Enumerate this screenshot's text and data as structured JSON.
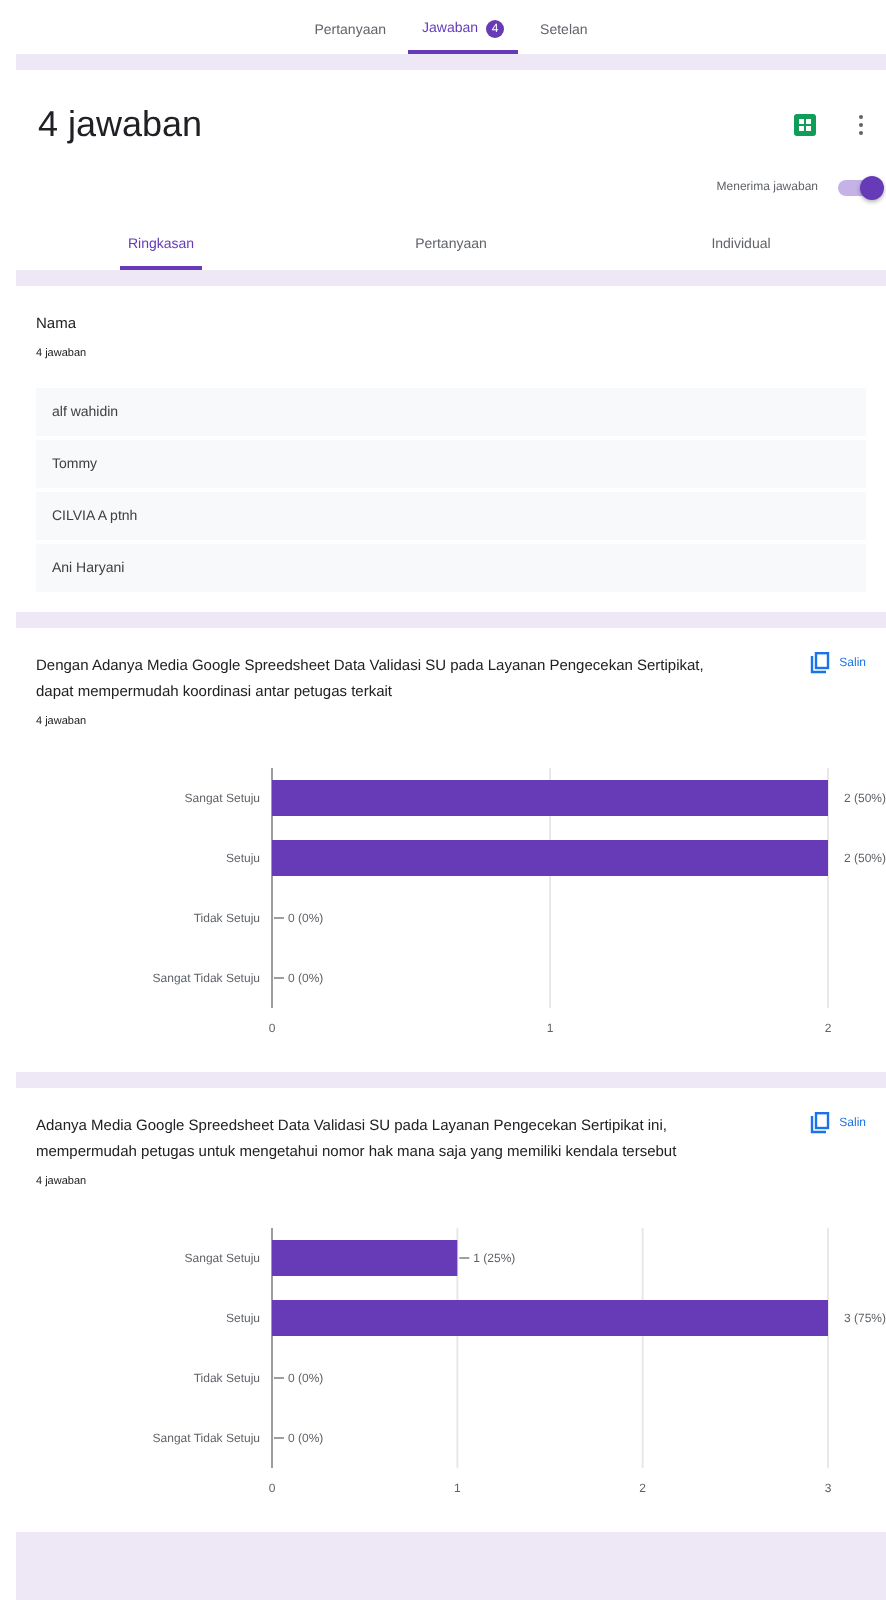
{
  "top_tabs": [
    {
      "label": "Pertanyaan",
      "selected": false
    },
    {
      "label": "Jawaban",
      "selected": true,
      "badge": "4"
    },
    {
      "label": "Setelan",
      "selected": false
    }
  ],
  "header": {
    "title": "4 jawaban",
    "accepting": {
      "label": "Menerima jawaban",
      "on": true
    }
  },
  "view_tabs": [
    {
      "label": "Ringkasan",
      "selected": true
    },
    {
      "label": "Pertanyaan",
      "selected": false
    },
    {
      "label": "Individual",
      "selected": false
    }
  ],
  "name_question": {
    "title": "Nama",
    "count": "4 jawaban",
    "answers": [
      "alf wahidin",
      "Tommy",
      "CILVIA A ptnh",
      "Ani Haryani"
    ]
  },
  "questions": [
    {
      "title": "Dengan Adanya Media Google Spreedsheet Data Validasi SU pada Layanan Pengecekan Sertipikat, dapat mempermudah koordinasi antar petugas terkait",
      "copy_label": "Salin",
      "count": "4 jawaban",
      "chart_data": {
        "type": "bar",
        "orientation": "horizontal",
        "categories": [
          "Sangat Setuju",
          "Setuju",
          "Tidak Setuju",
          "Sangat Tidak Setuju"
        ],
        "series": [
          {
            "color": "#673ab7",
            "values": [
              2,
              2,
              0,
              0
            ]
          }
        ],
        "xlim": [
          0,
          2
        ],
        "xticks": [
          0,
          1,
          2
        ],
        "value_labels": [
          "2 (50%)",
          "2 (50%)",
          "0 (0%)",
          "0 (0%)"
        ]
      }
    },
    {
      "title": "Adanya Media Google Spreedsheet Data Validasi SU pada Layanan Pengecekan Sertipikat ini, mempermudah petugas untuk mengetahui nomor hak mana saja yang memiliki kendala tersebut",
      "copy_label": "Salin",
      "count": "4 jawaban",
      "chart_data": {
        "type": "bar",
        "orientation": "horizontal",
        "categories": [
          "Sangat Setuju",
          "Setuju",
          "Tidak Setuju",
          "Sangat Tidak Setuju"
        ],
        "series": [
          {
            "color": "#673ab7",
            "values": [
              1,
              3,
              0,
              0
            ]
          }
        ],
        "xlim": [
          0,
          3
        ],
        "xticks": [
          0,
          1,
          2,
          3
        ],
        "value_labels": [
          "1 (25%)",
          "3 (75%)",
          "0 (0%)",
          "0 (0%)"
        ]
      }
    }
  ]
}
